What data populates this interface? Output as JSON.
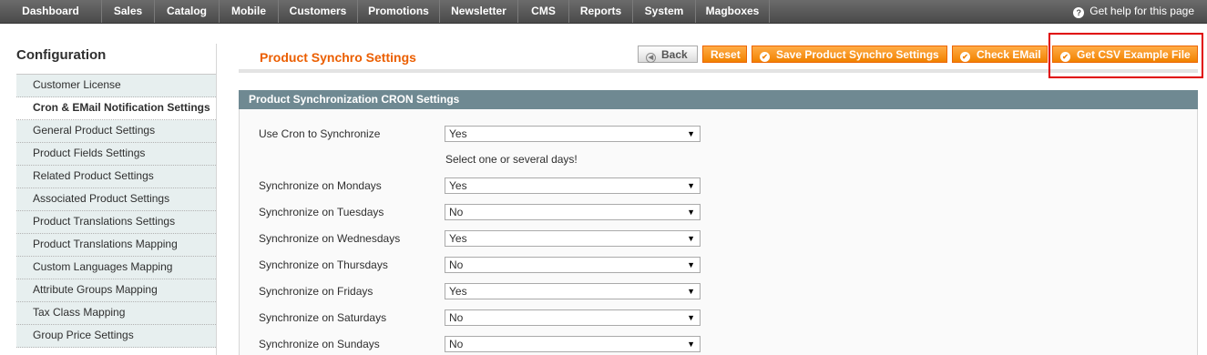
{
  "nav": {
    "items": [
      "Dashboard",
      "Sales",
      "Catalog",
      "Mobile",
      "Customers",
      "Promotions",
      "Newsletter",
      "CMS",
      "Reports",
      "System",
      "Magboxes"
    ],
    "help": "Get help for this page"
  },
  "sidebar": {
    "title": "Configuration",
    "items": [
      "Customer License",
      "Cron & EMail Notification Settings",
      "General Product Settings",
      "Product Fields Settings",
      "Related Product Settings",
      "Associated Product Settings",
      "Product Translations Settings",
      "Product Translations Mapping",
      "Custom Languages Mapping",
      "Attribute Groups Mapping",
      "Tax Class Mapping",
      "Group Price Settings"
    ],
    "active_index": 1
  },
  "header": {
    "title": "Product Synchro Settings",
    "buttons": {
      "back": "Back",
      "reset": "Reset",
      "save": "Save Product Synchro Settings",
      "check_email": "Check EMail",
      "get_csv": "Get CSV Example File"
    }
  },
  "section": {
    "title": "Product Synchronization CRON Settings",
    "note": "Select one or several days!",
    "rows": [
      {
        "label": "Use Cron to Synchronize",
        "value": "Yes"
      },
      {
        "label": "Synchronize on Mondays",
        "value": "Yes"
      },
      {
        "label": "Synchronize on Tuesdays",
        "value": "No"
      },
      {
        "label": "Synchronize on Wednesdays",
        "value": "Yes"
      },
      {
        "label": "Synchronize on Thursdays",
        "value": "No"
      },
      {
        "label": "Synchronize on Fridays",
        "value": "Yes"
      },
      {
        "label": "Synchronize on Saturdays",
        "value": "No"
      },
      {
        "label": "Synchronize on Sundays",
        "value": "No"
      }
    ]
  },
  "colors": {
    "accent": "#eb5e00",
    "button": "#f18200",
    "nav_bg": "#4a4a4a",
    "section_head": "#6f8992",
    "highlight": "#e00000"
  }
}
